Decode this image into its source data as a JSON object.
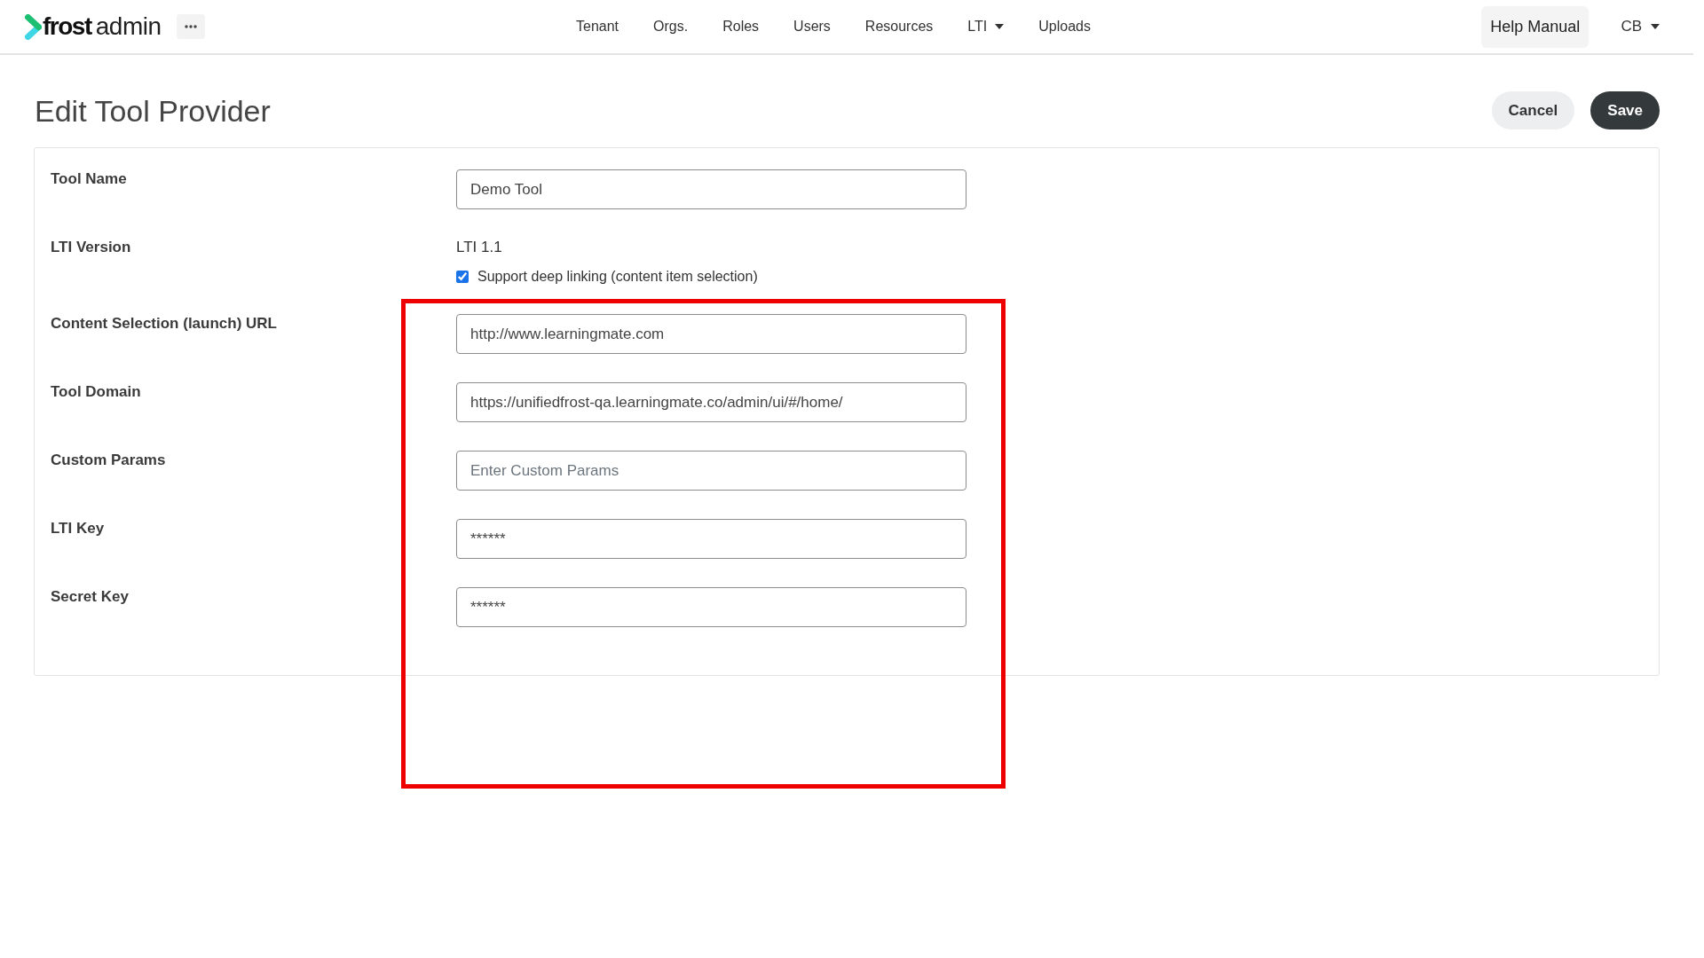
{
  "navbar": {
    "brand": {
      "name": "frost",
      "suffix": "admin"
    },
    "links": [
      {
        "label": "Tenant",
        "kind": "link"
      },
      {
        "label": "Orgs.",
        "kind": "link"
      },
      {
        "label": "Roles",
        "kind": "link"
      },
      {
        "label": "Users",
        "kind": "link"
      },
      {
        "label": "Resources",
        "kind": "link"
      },
      {
        "label": "LTI",
        "kind": "dropdown"
      },
      {
        "label": "Uploads",
        "kind": "link"
      }
    ],
    "help_button": "Help Manual",
    "user_menu": "CB"
  },
  "page": {
    "title": "Edit Tool Provider",
    "actions": [
      {
        "label": "Cancel",
        "kind": "secondary"
      },
      {
        "label": "Save",
        "kind": "primary"
      }
    ]
  },
  "form": {
    "fields": [
      {
        "label": "Tool Name",
        "kind": "input",
        "value": "Demo Tool"
      },
      {
        "label": "LTI Version",
        "kind": "static",
        "value": "LTI 1.1",
        "checkbox": {
          "label": "Support deep linking (content item selection)",
          "checked": true
        }
      },
      {
        "label": "Content Selection (launch) URL",
        "kind": "input",
        "value": "http://www.learningmate.com"
      },
      {
        "label": "Tool Domain",
        "kind": "input",
        "value": "https://unifiedfrost-qa.learningmate.co/admin/ui/#/home/"
      },
      {
        "label": "Custom Params",
        "kind": "input",
        "placeholder": "Enter Custom Params"
      },
      {
        "label": "LTI Key",
        "kind": "input",
        "value": "******"
      },
      {
        "label": "Secret Key",
        "kind": "input",
        "value": "******"
      }
    ]
  },
  "annotations": [
    {
      "kind": "rectangle"
    }
  ]
}
